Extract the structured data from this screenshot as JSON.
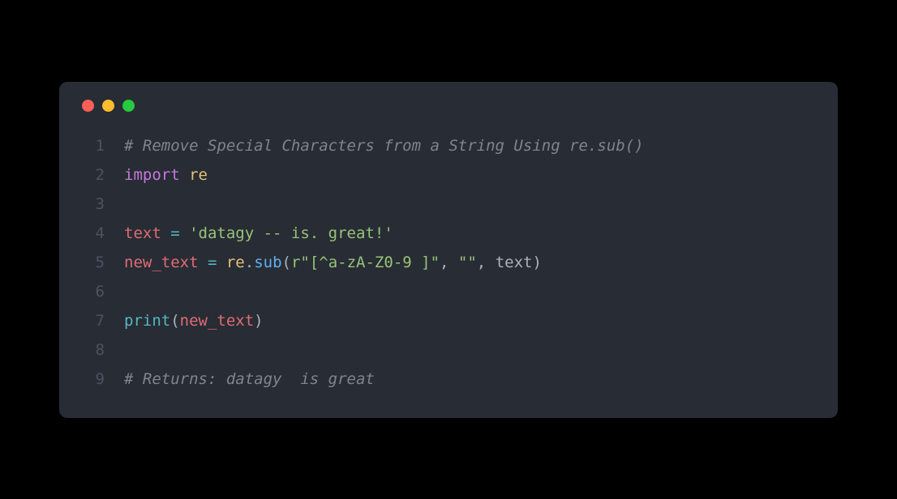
{
  "window": {
    "controls": [
      "close",
      "minimize",
      "zoom"
    ]
  },
  "code": {
    "lines": [
      {
        "num": "1",
        "tokens": {
          "comment": "# Remove Special Characters from a String Using re.sub()"
        }
      },
      {
        "num": "2",
        "tokens": {
          "import": "import",
          "re": "re"
        }
      },
      {
        "num": "3",
        "tokens": {}
      },
      {
        "num": "4",
        "tokens": {
          "text_var": "text ",
          "eq": "=",
          "str": " 'datagy -- is. great!'"
        }
      },
      {
        "num": "5",
        "tokens": {
          "newtext": "new_text ",
          "eq": "=",
          "sp": " ",
          "re": "re",
          "dot": ".",
          "sub": "sub",
          "lp": "(",
          "r": "r\"[^a-zA-Z0-9 ]\"",
          "c1": ", ",
          "empty": "\"\"",
          "c2": ", ",
          "txt": "text",
          "rp": ")"
        }
      },
      {
        "num": "6",
        "tokens": {}
      },
      {
        "num": "7",
        "tokens": {
          "print": "print",
          "lp": "(",
          "arg": "new_text",
          "rp": ")"
        }
      },
      {
        "num": "8",
        "tokens": {}
      },
      {
        "num": "9",
        "tokens": {
          "comment": "# Returns: datagy  is great"
        }
      }
    ]
  }
}
